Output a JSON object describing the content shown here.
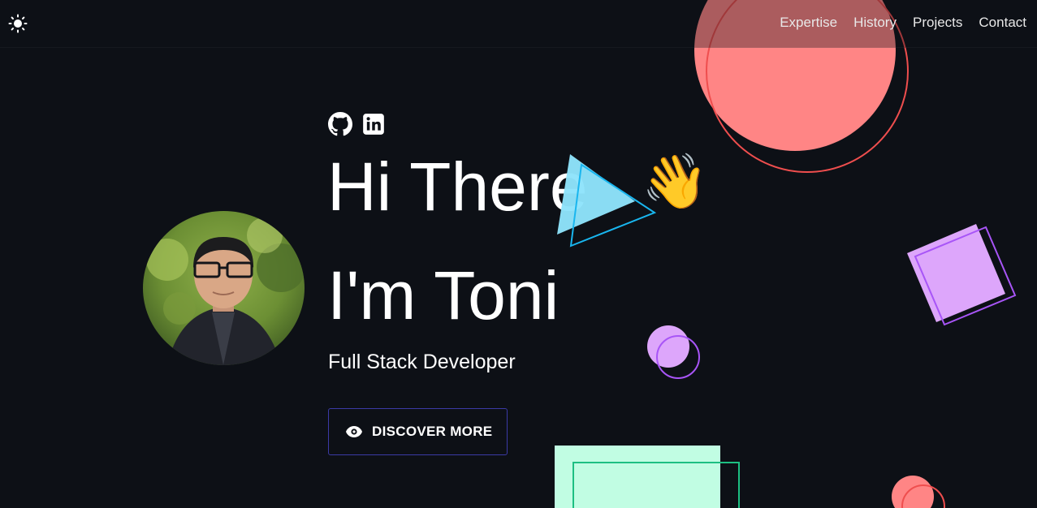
{
  "nav": {
    "items": [
      "Expertise",
      "History",
      "Projects",
      "Contact"
    ]
  },
  "hero": {
    "line1": "Hi There",
    "line2": "I'm Toni",
    "subtitle": "Full Stack Developer",
    "wave_emoji": "👋"
  },
  "cta": {
    "label": "DISCOVER MORE"
  },
  "icons": {
    "theme": "sun-icon",
    "github": "github-icon",
    "linkedin": "linkedin-icon",
    "cta": "eye-icon"
  },
  "colors": {
    "background": "#0d1016",
    "coral": "#ff8585",
    "coral_outline": "#ef4e4e",
    "cyan": "#8ee3fb",
    "cyan_outline": "#19b6ef",
    "purple": "#dda6fb",
    "purple_outline": "#a855f7",
    "mint": "#c1fde3",
    "mint_outline": "#1dbf82",
    "button_border": "#3b3aa6"
  }
}
